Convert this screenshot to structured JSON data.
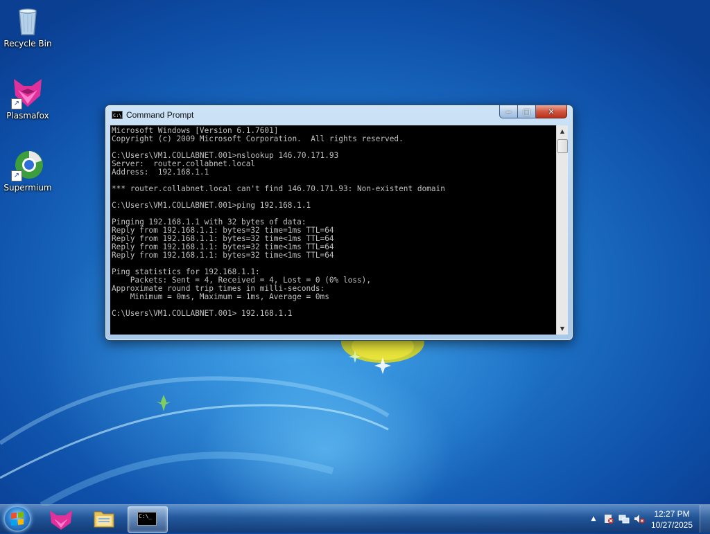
{
  "desktop": {
    "icons": [
      {
        "label": "Recycle Bin",
        "icon": "recycle-bin-icon"
      },
      {
        "label": "Plasmafox",
        "icon": "plasmafox-icon"
      },
      {
        "label": "Supermium",
        "icon": "supermium-icon"
      }
    ]
  },
  "window": {
    "title": "Command Prompt",
    "icon": "cmd-icon",
    "title_icon_text": "C:\\",
    "minimize_label": "‒",
    "maximize_label": "□",
    "close_label": "✕",
    "console_lines": [
      "Microsoft Windows [Version 6.1.7601]",
      "Copyright (c) 2009 Microsoft Corporation.  All rights reserved.",
      "",
      "C:\\Users\\VM1.COLLABNET.001>nslookup 146.70.171.93",
      "Server:  router.collabnet.local",
      "Address:  192.168.1.1",
      "",
      "*** router.collabnet.local can't find 146.70.171.93: Non-existent domain",
      "",
      "C:\\Users\\VM1.COLLABNET.001>ping 192.168.1.1",
      "",
      "Pinging 192.168.1.1 with 32 bytes of data:",
      "Reply from 192.168.1.1: bytes=32 time=1ms TTL=64",
      "Reply from 192.168.1.1: bytes=32 time<1ms TTL=64",
      "Reply from 192.168.1.1: bytes=32 time<1ms TTL=64",
      "Reply from 192.168.1.1: bytes=32 time<1ms TTL=64",
      "",
      "Ping statistics for 192.168.1.1:",
      "    Packets: Sent = 4, Received = 4, Lost = 0 (0% loss),",
      "Approximate round trip times in milli-seconds:",
      "    Minimum = 0ms, Maximum = 1ms, Average = 0ms",
      "",
      "C:\\Users\\VM1.COLLABNET.001> 192.168.1.1"
    ]
  },
  "taskbar": {
    "items": [
      {
        "name": "start-button",
        "icon": "windows-logo-icon"
      },
      {
        "name": "taskbar-plasmafox",
        "icon": "plasmafox-icon"
      },
      {
        "name": "taskbar-explorer",
        "icon": "folder-icon"
      },
      {
        "name": "taskbar-command-prompt",
        "icon": "cmd-icon",
        "active": true
      }
    ],
    "tray": {
      "show_hidden_label": "▲",
      "icons": [
        "action-center-icon",
        "network-icon",
        "volume-muted-icon"
      ],
      "time": "12:27 PM",
      "date": "10/27/2025"
    },
    "cmd_icon_text": "C:\\_"
  },
  "colors": {
    "console_bg": "#000000",
    "console_fg": "#c0c0c0",
    "close_button": "#c9462f",
    "desktop_blue": "#1c6fc4"
  }
}
